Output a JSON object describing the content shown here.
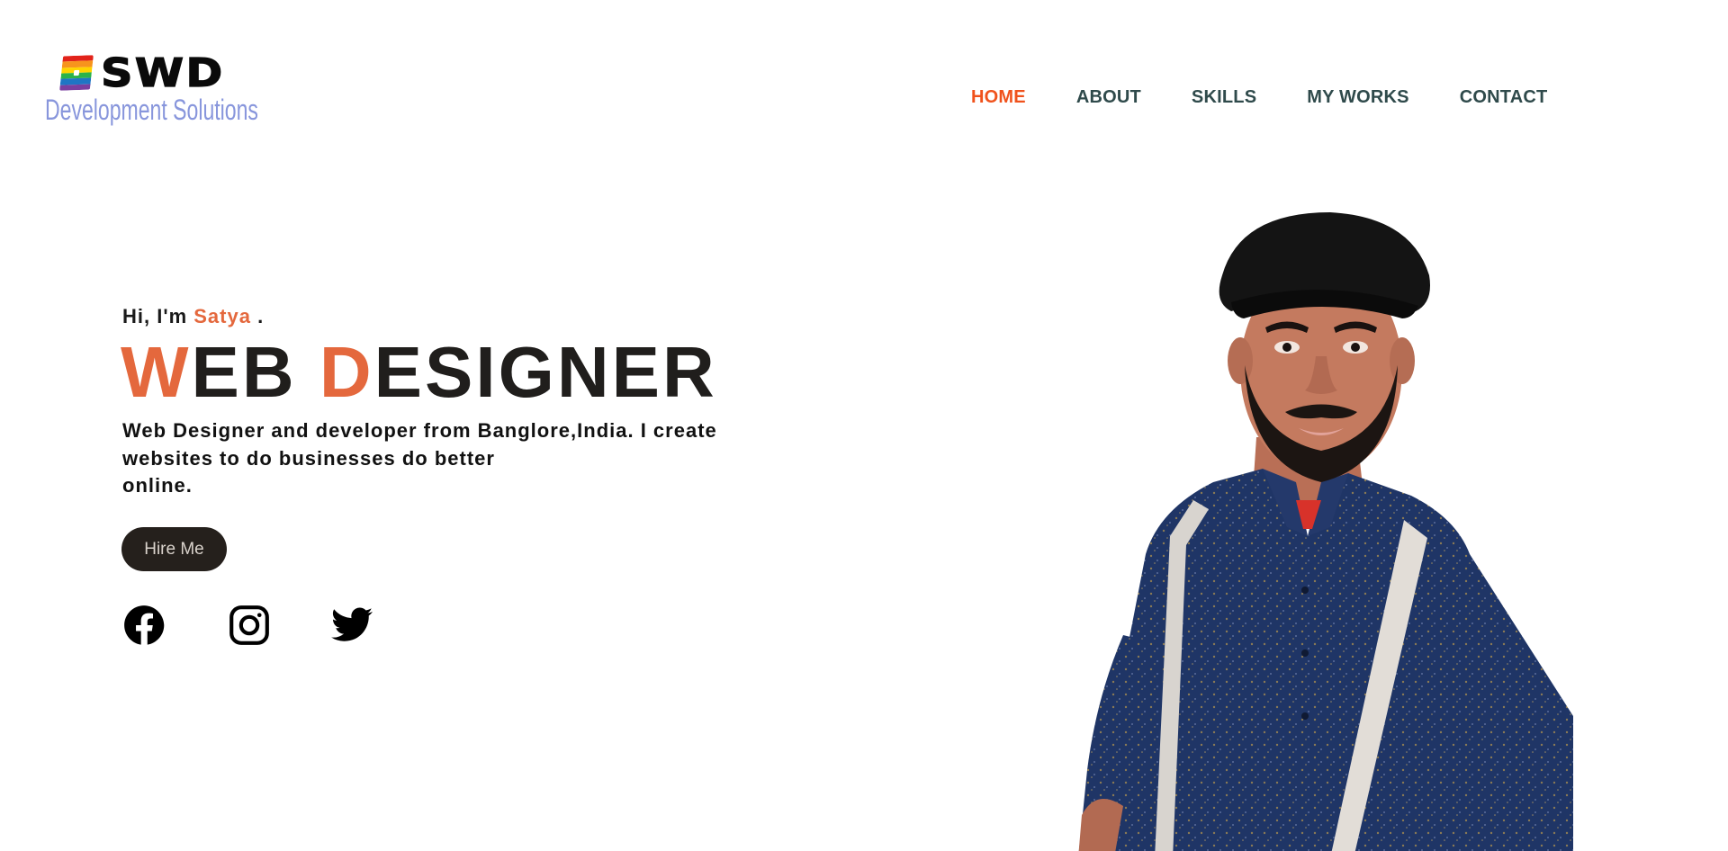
{
  "header": {
    "logo": {
      "brand": "SWD",
      "tagline": "Development Solutions"
    },
    "nav": [
      {
        "label": "HOME",
        "active": true
      },
      {
        "label": "ABOUT",
        "active": false
      },
      {
        "label": "SKILLS",
        "active": false
      },
      {
        "label": "MY WORKS",
        "active": false
      },
      {
        "label": "CONTACT",
        "active": false
      }
    ]
  },
  "hero": {
    "greeting_prefix": "Hi, I'm ",
    "name": "Satya",
    "greeting_suffix": " .",
    "headline": {
      "w": "W",
      "eb": "EB ",
      "d": "D",
      "esigner": "ESIGNER"
    },
    "description_lines": [
      "Web Designer and developer from Banglore,India. I create",
      "websites to do businesses do better",
      "online."
    ],
    "hire_button": "Hire Me",
    "social": [
      {
        "icon": "facebook-icon"
      },
      {
        "icon": "instagram-icon"
      },
      {
        "icon": "twitter-icon"
      }
    ]
  },
  "colors": {
    "accent": "#e4683d",
    "nav_active": "#f0521c",
    "nav_text": "#2f4a4b",
    "headline": "#201e1c",
    "button_bg": "#25201c",
    "tagline": "#8896dc"
  }
}
